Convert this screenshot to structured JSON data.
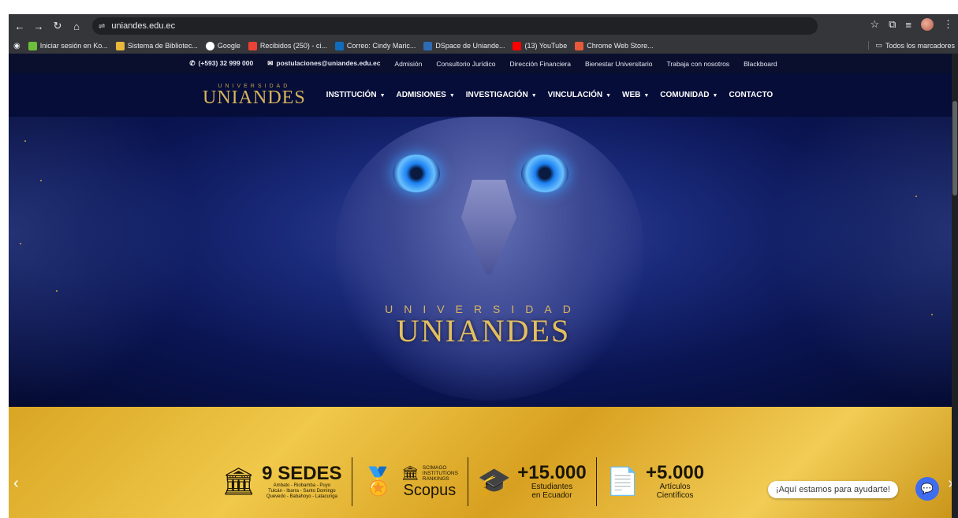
{
  "browser": {
    "url": "uniandes.edu.ec",
    "bookmarks": [
      {
        "label": "Iniciar sesión en Ko...",
        "color": "#6bbf3a"
      },
      {
        "label": "Sistema de Bibliotec...",
        "color": "#e8b83a"
      },
      {
        "label": "Google",
        "color": "#ffffff"
      },
      {
        "label": "Recibidos (250) - ci...",
        "color": "#ea4335"
      },
      {
        "label": "Correo: Cindy Maric...",
        "color": "#0f6cbd"
      },
      {
        "label": "DSpace de Uniande...",
        "color": "#2d6bb3"
      },
      {
        "label": "(13) YouTube",
        "color": "#ff0000"
      },
      {
        "label": "Chrome Web Store...",
        "color": "#e65a3a"
      }
    ],
    "all_bookmarks": "Todos los marcadores"
  },
  "topinfo": {
    "phone": "(+593) 32 999 000",
    "email": "postulaciones@uniandes.edu.ec",
    "links": [
      "Admisión",
      "Consultorio Jurídico",
      "Dirección Financiera",
      "Bienestar Universitario",
      "Trabaja con nosotros",
      "Blackboard"
    ]
  },
  "logo": {
    "small": "UNIVERSIDAD",
    "big": "UNIANDES"
  },
  "menu": [
    {
      "label": "INSTITUCIÓN",
      "dropdown": true
    },
    {
      "label": "ADMISIONES",
      "dropdown": true
    },
    {
      "label": "INVESTIGACIÓN",
      "dropdown": true
    },
    {
      "label": "VINCULACIÓN",
      "dropdown": true
    },
    {
      "label": "WEB",
      "dropdown": true
    },
    {
      "label": "COMUNIDAD",
      "dropdown": true
    },
    {
      "label": "CONTACTO",
      "dropdown": false
    }
  ],
  "hero": {
    "small": "UNIVERSIDAD",
    "big": "UNIANDES"
  },
  "stats": {
    "sedes": {
      "num": "9 SEDES",
      "sub1": "Ambato - Riobamba - Puyo",
      "sub2": "Tulcán - Ibarra - Santo Domingo",
      "sub3": "Quevedo - Babahoyo - Latacunga"
    },
    "ranking": {
      "l1": "SCIMAGO",
      "l2": "INSTITUTIONS",
      "l3": "RANKINGS",
      "scopus": "Scopus"
    },
    "students": {
      "num": "+15.000",
      "l1": "Estudiantes",
      "l2": "en Ecuador"
    },
    "articles": {
      "num": "+5.000",
      "l1": "Artículos",
      "l2": "Científicos"
    }
  },
  "chat": {
    "text": "¡Aquí estamos para ayudarte!"
  }
}
